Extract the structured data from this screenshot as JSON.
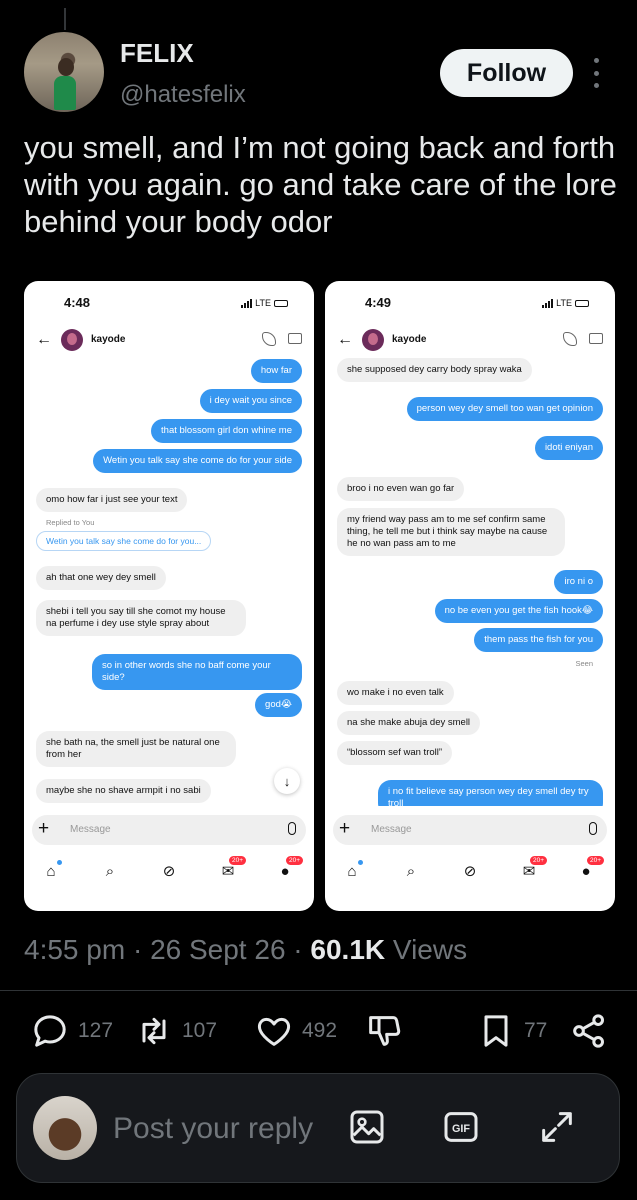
{
  "colors": {
    "accent": "#1d9bf0",
    "follow_bg": "#eff3f4",
    "ig_blue": "#3797f0"
  },
  "header": {
    "name": "FELIX",
    "handle": "@hatesfelix",
    "follow_label": "Follow",
    "more_icon": "more-vertical-icon"
  },
  "tweet": {
    "text": "you smell, and I’m not going back and forth with you again. go and take care of the lore behind your body odor"
  },
  "screenshots": [
    {
      "time": "4:48",
      "network": "LTE",
      "contact": "kayode",
      "composer_placeholder": "Message",
      "badges": [
        "20+",
        "20+"
      ],
      "messages": [
        {
          "dir": "out",
          "text": "how far"
        },
        {
          "dir": "out",
          "text": "i dey wait you since"
        },
        {
          "dir": "out",
          "text": "that blossom girl don whine me"
        },
        {
          "dir": "out",
          "text": "Wetin you talk say she come do for your side"
        },
        {
          "dir": "in",
          "text": "omo how far i just see your text"
        },
        {
          "dir": "label",
          "text": "Replied to You"
        },
        {
          "dir": "quote",
          "text": "Wetin you talk say she come do for you..."
        },
        {
          "dir": "in",
          "text": "ah that one wey dey smell"
        },
        {
          "dir": "in",
          "text": "shebi i tell you say till she comot my house na perfume i dey use style spray about"
        },
        {
          "dir": "out",
          "text": "so in other words she no baff come your side?"
        },
        {
          "dir": "out",
          "text": "god😭"
        },
        {
          "dir": "in",
          "text": "she bath na, the smell just be natural one from her"
        },
        {
          "dir": "in",
          "text": "maybe she no shave armpit i no sabi"
        }
      ]
    },
    {
      "time": "4:49",
      "network": "LTE",
      "contact": "kayode",
      "composer_placeholder": "Message",
      "badges": [
        "20+",
        "20+"
      ],
      "messages": [
        {
          "dir": "in",
          "text": "she supposed dey carry body spray waka"
        },
        {
          "dir": "out",
          "text": "person wey dey smell too wan get opinion"
        },
        {
          "dir": "out",
          "text": "idoti eniyan"
        },
        {
          "dir": "in",
          "text": "broo i no even wan go far"
        },
        {
          "dir": "in",
          "text": "my friend way pass am to me sef confirm same thing, he tell me but i think say maybe na cause he no wan pass am to me"
        },
        {
          "dir": "out",
          "text": "iro ni o"
        },
        {
          "dir": "out",
          "text": "no be even you get the fish hook😂"
        },
        {
          "dir": "out",
          "text": "them pass the fish for you"
        },
        {
          "dir": "seen",
          "text": "Seen"
        },
        {
          "dir": "in",
          "text": "wo make i no even talk"
        },
        {
          "dir": "in",
          "text": "na she make abuja dey smell"
        },
        {
          "dir": "in",
          "text": "“blossom sef wan troll”"
        },
        {
          "dir": "out",
          "text": "i no fit believe say person wey dey smell dey try troll"
        }
      ]
    }
  ],
  "meta": {
    "time": "4:55 pm",
    "date": "26 Sept 26",
    "views_count": "60.1K",
    "views_label": "Views",
    "dot": "·"
  },
  "actions": {
    "replies": "127",
    "reposts": "107",
    "likes": "492",
    "bookmarks": "77"
  },
  "reply_bar": {
    "placeholder": "Post your reply"
  }
}
